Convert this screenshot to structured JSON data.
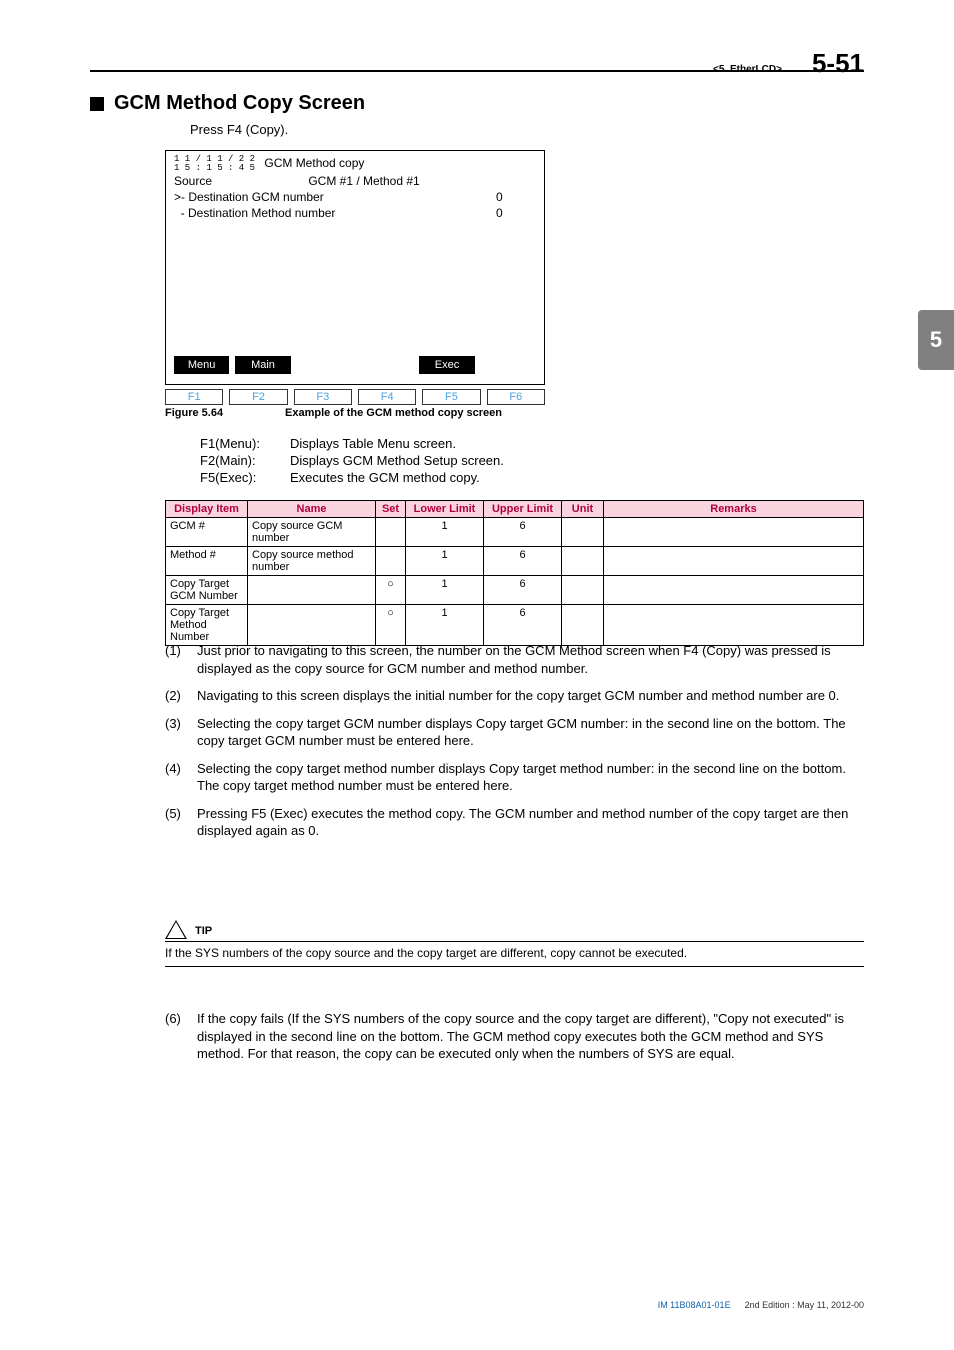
{
  "header": {
    "crumb": "<5.  EtherLCD>",
    "pagenum": "5-51"
  },
  "section": {
    "title": "GCM Method Copy Screen",
    "press": "Press F4 (Copy)."
  },
  "lcd": {
    "ts_l1": "1 1 / 1 1 / 2 2",
    "ts_l2": "1 5 : 1 5 : 4 5",
    "title": "GCM Method copy",
    "source_label": "Source",
    "source_value": "GCM #1   /   Method #1",
    "row1_label": ">- Destination GCM number",
    "row1_val": "0",
    "row2_label": "  - Destination Method number",
    "row2_val": "0",
    "btns_top": [
      "Menu",
      "Main",
      "",
      "",
      "Exec",
      ""
    ],
    "btns_bot": [
      "F1",
      "F2",
      "F3",
      "F4",
      "F5",
      "F6"
    ]
  },
  "figcap": {
    "label": "Figure 5.64",
    "text": "Example of the GCM method copy screen"
  },
  "legend": [
    {
      "k": "F1(Menu):",
      "v": "Displays Table Menu screen."
    },
    {
      "k": "F2(Main):",
      "v": "Displays GCM Method Setup screen."
    },
    {
      "k": "F5(Exec):",
      "v": "Executes the GCM method copy."
    }
  ],
  "table": {
    "headers": [
      "Display Item",
      "Name",
      "Set",
      "Lower Limit",
      "Upper Limit",
      "Unit",
      "Remarks"
    ],
    "rows": [
      {
        "c": [
          "GCM #",
          "Copy source GCM number",
          "",
          "1",
          "6",
          "",
          ""
        ]
      },
      {
        "c": [
          "Method #",
          "Copy source method number",
          "",
          "1",
          "6",
          "",
          ""
        ]
      },
      {
        "c": [
          "Copy Target GCM Number",
          "",
          "○",
          "1",
          "6",
          "",
          ""
        ]
      },
      {
        "c": [
          "Copy Target Method Number",
          "",
          "○",
          "1",
          "6",
          "",
          ""
        ]
      }
    ]
  },
  "numlist": [
    {
      "n": "(1)",
      "t": "Just prior to navigating to this screen, the number on the GCM Method screen when F4 (Copy) was pressed is displayed as the copy source for GCM number and method number."
    },
    {
      "n": "(2)",
      "t": "Navigating to this screen displays the initial number for the copy target GCM number and method number are 0."
    },
    {
      "n": "(3)",
      "t": "Selecting the copy target GCM number displays Copy target GCM number: in the second line on the bottom. The copy target GCM number must be entered here."
    },
    {
      "n": "(4)",
      "t": "Selecting the copy target method number displays Copy target method number: in the second line on the bottom. The copy target method number must be entered here."
    },
    {
      "n": "(5)",
      "t": "Pressing F5 (Exec) executes the method copy. The GCM number and method number of the copy target are then displayed again as 0."
    }
  ],
  "tip": {
    "label": "TIP",
    "body": "If the SYS numbers of the copy source and the copy target are different, copy cannot be executed."
  },
  "item6": {
    "n": "(6)",
    "t": "If the copy fails (If the SYS numbers of the copy source and the copy target are different), \"Copy not executed\" is displayed in the second line on the bottom. The GCM method copy executes both the GCM method and SYS method. For that reason, the copy can be executed only when the numbers of SYS are equal."
  },
  "sidetab": "5",
  "footer": {
    "code": "IM 11B08A01-01E",
    "edition": "2nd Edition : May 11, 2012-00"
  }
}
